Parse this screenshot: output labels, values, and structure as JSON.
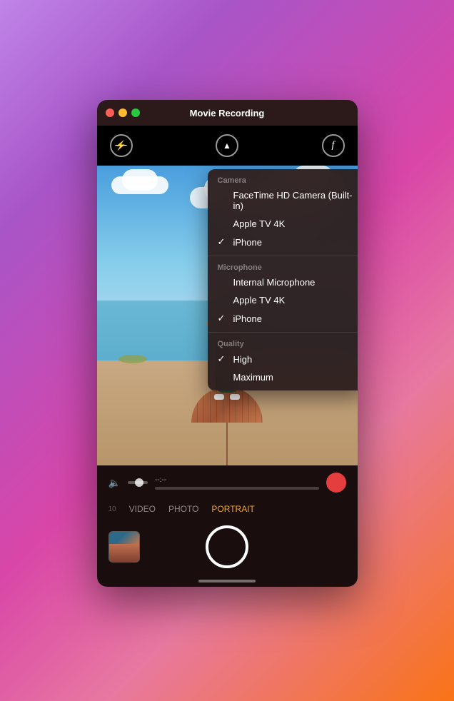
{
  "window": {
    "title": "Movie Recording"
  },
  "traffic_lights": {
    "close": "close",
    "minimize": "minimize",
    "maximize": "maximize"
  },
  "controls": {
    "flash_icon": "✕",
    "chevron_icon": "⌃",
    "facetime_icon": "f"
  },
  "bottom_controls": {
    "time": "--:--",
    "record_title": "Record"
  },
  "modes": [
    {
      "id": "video",
      "label": "VIDEO",
      "active": false
    },
    {
      "id": "photo",
      "label": "PHOTO",
      "active": false
    },
    {
      "id": "portrait",
      "label": "PORTRAIT",
      "active": true
    }
  ],
  "dropdown": {
    "camera_section": {
      "header": "Camera",
      "items": [
        {
          "id": "facetime-hd",
          "label": "FaceTime HD Camera (Built-in)",
          "checked": false
        },
        {
          "id": "apple-tv-4k-camera",
          "label": "Apple TV 4K",
          "checked": false
        },
        {
          "id": "iphone-camera",
          "label": "iPhone",
          "checked": true
        }
      ]
    },
    "microphone_section": {
      "header": "Microphone",
      "items": [
        {
          "id": "internal-mic",
          "label": "Internal Microphone",
          "checked": false
        },
        {
          "id": "apple-tv-4k-mic",
          "label": "Apple TV 4K",
          "checked": false
        },
        {
          "id": "iphone-mic",
          "label": "iPhone",
          "checked": true
        }
      ]
    },
    "quality_section": {
      "header": "Quality",
      "items": [
        {
          "id": "high",
          "label": "High",
          "checked": true
        },
        {
          "id": "maximum",
          "label": "Maximum",
          "checked": false
        }
      ]
    }
  }
}
